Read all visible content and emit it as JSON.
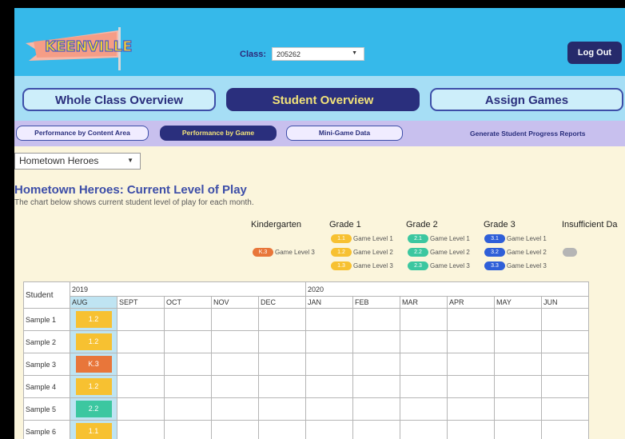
{
  "app": {
    "logo_text": "KEENVILLE"
  },
  "header": {
    "class_label": "Class:",
    "class_value": "205262",
    "logout_label": "Log Out"
  },
  "nav": {
    "tabs": [
      {
        "label": "Whole Class Overview"
      },
      {
        "label": "Student Overview"
      },
      {
        "label": "Assign Games"
      }
    ]
  },
  "subnav": {
    "tabs": [
      {
        "label": "Performance by Content Area"
      },
      {
        "label": "Performance by Game"
      },
      {
        "label": "Mini-Game Data"
      }
    ],
    "generate_label": "Generate Student Progress Reports"
  },
  "game_select": {
    "value": "Hometown Heroes"
  },
  "chart": {
    "title": "Hometown Heroes: Current Level of Play",
    "subtitle": "The chart below shows current student level of play for each month."
  },
  "legend": {
    "groups": [
      {
        "title": "Kindergarten"
      },
      {
        "title": "Grade 1"
      },
      {
        "title": "Grade 2"
      },
      {
        "title": "Grade 3"
      },
      {
        "title": "Insufficient Da"
      }
    ],
    "k": {
      "code": "K.3",
      "text": "Game Level 3"
    },
    "g1": [
      {
        "code": "1.1",
        "text": "Game Level 1"
      },
      {
        "code": "1.2",
        "text": "Game Level 2"
      },
      {
        "code": "1.3",
        "text": "Game Level 3"
      }
    ],
    "g2": [
      {
        "code": "2.1",
        "text": "Game Level 1"
      },
      {
        "code": "2.2",
        "text": "Game Level 2"
      },
      {
        "code": "2.3",
        "text": "Game Level 3"
      }
    ],
    "g3": [
      {
        "code": "3.1",
        "text": "Game Level 1"
      },
      {
        "code": "3.2",
        "text": "Game Level 2"
      },
      {
        "code": "3.3",
        "text": "Game Level 3"
      }
    ],
    "colors": {
      "kinder": "#e8763a",
      "grade1": "#f7c131",
      "grade2": "#3cc7a0",
      "grade3": "#2f5fd8",
      "insufficient": "#b5b5b5"
    }
  },
  "table": {
    "student_header": "Student",
    "year_2019": "2019",
    "year_2020": "2020",
    "months": [
      "AUG",
      "SEPT",
      "OCT",
      "NOV",
      "DEC",
      "JAN",
      "FEB",
      "MAR",
      "APR",
      "MAY",
      "JUN"
    ],
    "rows": [
      {
        "name": "Sample 1",
        "aug": "1.2"
      },
      {
        "name": "Sample 2",
        "aug": "1.2"
      },
      {
        "name": "Sample 3",
        "aug": "K.3"
      },
      {
        "name": "Sample 4",
        "aug": "1.2"
      },
      {
        "name": "Sample 5",
        "aug": "2.2"
      },
      {
        "name": "Sample 6",
        "aug": "1.1"
      }
    ]
  }
}
